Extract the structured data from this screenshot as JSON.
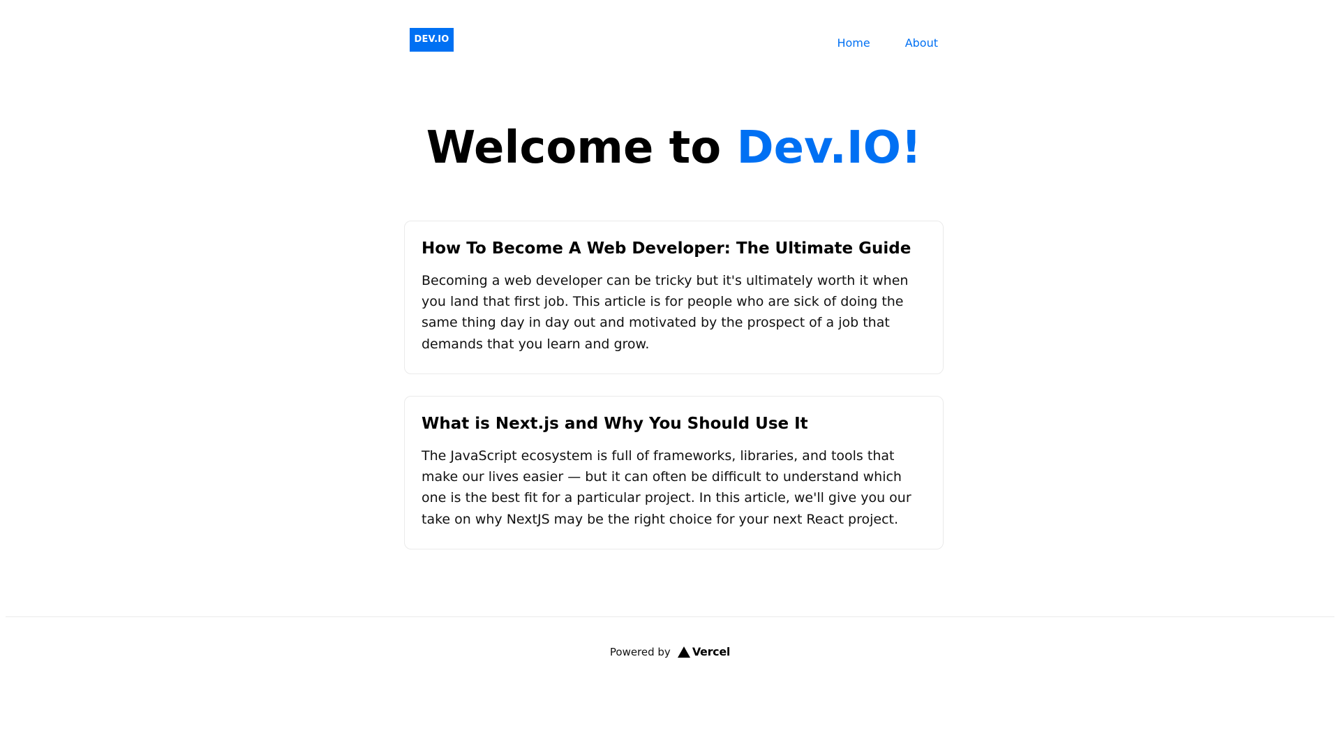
{
  "header": {
    "logo_text": "DEV.IO",
    "nav": [
      {
        "label": "Home"
      },
      {
        "label": "About"
      }
    ]
  },
  "hero": {
    "prefix": "Welcome to ",
    "accent": "Dev.IO!"
  },
  "posts": [
    {
      "title": "How To Become A Web Developer: The Ultimate Guide",
      "excerpt": "Becoming a web developer can be tricky but it's ultimately worth it when you land that first job. This article is for people who are sick of doing the same thing day in day out and motivated by the prospect of a job that demands that you learn and grow."
    },
    {
      "title": "What is Next.js and Why You Should Use It",
      "excerpt": "The JavaScript ecosystem is full of frameworks, libraries, and tools that make our lives easier — but it can often be difficult to understand which one is the best fit for a particular project. In this article, we'll give you our take on why NextJS may be the right choice for your next React project."
    }
  ],
  "footer": {
    "powered_by": "Powered by",
    "brand": "Vercel",
    "brand_icon": "vercel-triangle-icon"
  },
  "colors": {
    "accent": "#0070f3",
    "border": "#eaeaea",
    "text": "#111111",
    "background": "#ffffff"
  }
}
